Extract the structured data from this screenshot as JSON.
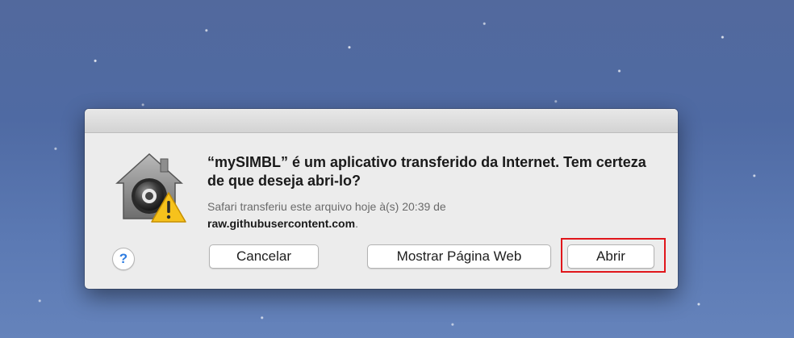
{
  "dialog": {
    "heading": "“mySIMBL” é um aplicativo transferido da Internet. Tem certeza de que deseja abri-lo?",
    "info_prefix": "Safari transferiu este arquivo hoje à(s) 20:39 de",
    "info_host": "raw.githubusercontent.com",
    "info_suffix": ".",
    "icon": "gatekeeper-warning-icon"
  },
  "buttons": {
    "help_label": "?",
    "cancel_label": "Cancelar",
    "show_webpage_label": "Mostrar Página Web",
    "open_label": "Abrir"
  },
  "colors": {
    "highlight": "#e0161b",
    "help_accent": "#2f7de1",
    "warning": "#f6c21c"
  }
}
